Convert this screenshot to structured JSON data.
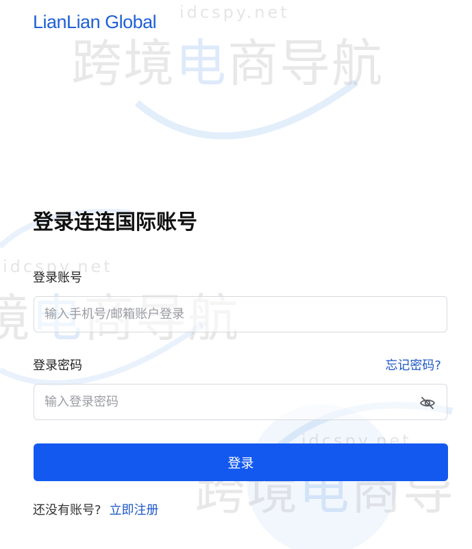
{
  "brand": {
    "logo_text": "LianLian Global",
    "accent_color": "#1359f0",
    "link_color": "#1d58c7"
  },
  "watermark": {
    "site": "idcspy.net",
    "slogan": "跨境电商导航",
    "slogan_lead": "跨境",
    "slogan_accent": "电",
    "slogan_tail": "商导航",
    "slogan_partial": "境电商导航",
    "slogan_partial_lead": "境",
    "slogan_partial_accent": "电",
    "slogan_partial_tail": "商导航",
    "slogan_cut": "跨境电商导",
    "slogan_cut_lead": "跨境",
    "slogan_cut_accent": "电",
    "slogan_cut_tail": "商导"
  },
  "login": {
    "title": "登录连连国际账号",
    "account": {
      "label": "登录账号",
      "placeholder": "输入手机号/邮箱账户登录",
      "value": ""
    },
    "password": {
      "label": "登录密码",
      "placeholder": "输入登录密码",
      "value": "",
      "forgot_link": "忘记密码?",
      "visibility_icon": "eye-off-icon"
    },
    "submit_label": "登录",
    "register": {
      "prompt": "还没有账号?",
      "link": "立即注册"
    }
  }
}
